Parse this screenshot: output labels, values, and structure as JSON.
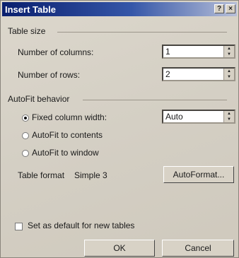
{
  "dialog": {
    "title": "Insert Table",
    "title_buttons": [
      "?",
      "×"
    ],
    "table_size": {
      "heading": "Table size",
      "columns_label": "Number of columns:",
      "columns_value": "1",
      "rows_label": "Number of rows:",
      "rows_value": "2"
    },
    "autofit": {
      "heading": "AutoFit behavior",
      "options": [
        {
          "label": "Fixed column width:",
          "selected": true
        },
        {
          "label": "AutoFit to contents",
          "selected": false
        },
        {
          "label": "AutoFit to window",
          "selected": false
        }
      ],
      "width_value": "Auto"
    },
    "table_format": {
      "label": "Table format",
      "value": "Simple 3",
      "autoformat_button": "AutoFormat..."
    },
    "default_checkbox_label": "Set as default for new tables",
    "ok_button": "OK",
    "cancel_button": "Cancel"
  }
}
